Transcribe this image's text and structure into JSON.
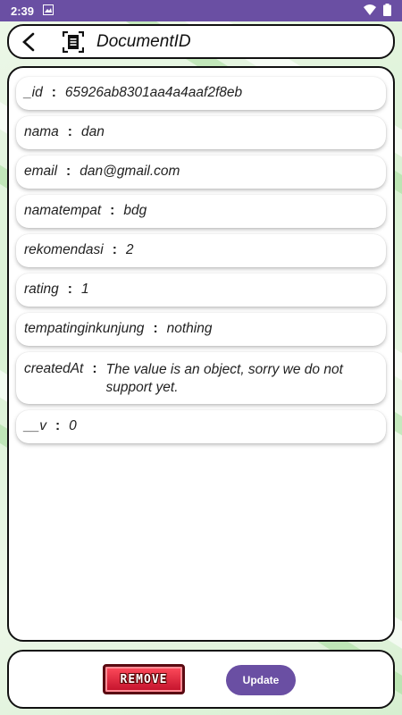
{
  "status": {
    "time": "2:39"
  },
  "appbar": {
    "title": "DocumentID"
  },
  "fields": [
    {
      "key": "_id",
      "value": "65926ab8301aa4a4aaf2f8eb"
    },
    {
      "key": "nama",
      "value": "dan"
    },
    {
      "key": "email",
      "value": "dan@gmail.com"
    },
    {
      "key": "namatempat",
      "value": "bdg"
    },
    {
      "key": "rekomendasi",
      "value": "2"
    },
    {
      "key": "rating",
      "value": "1"
    },
    {
      "key": "tempatinginkunjung",
      "value": "nothing"
    },
    {
      "key": "createdAt",
      "value": "The value is an object, sorry we do not support yet."
    },
    {
      "key": "__v",
      "value": "0"
    }
  ],
  "separator": ":",
  "footer": {
    "remove_label": "REMOVE",
    "update_label": "Update"
  },
  "colors": {
    "accent": "#6a4fa3",
    "remove": "#e0203a"
  }
}
